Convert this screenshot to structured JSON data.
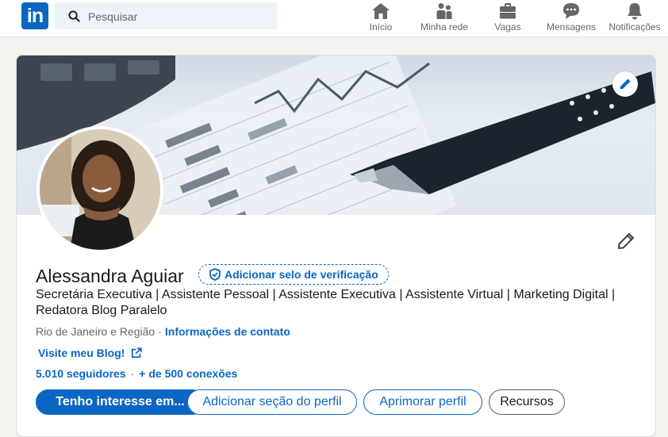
{
  "nav": {
    "logo": "in",
    "search_placeholder": "Pesquisar",
    "items": [
      {
        "label": "Início",
        "icon": "home-icon"
      },
      {
        "label": "Minha rede",
        "icon": "network-icon"
      },
      {
        "label": "Vagas",
        "icon": "briefcase-icon"
      },
      {
        "label": "Mensagens",
        "icon": "messaging-icon"
      },
      {
        "label": "Notificações",
        "icon": "bell-icon"
      }
    ]
  },
  "profile": {
    "name": "Alessandra Aguiar",
    "verify_label": "Adicionar selo de verificação",
    "headline": "Secretária Executiva | Assistente Pessoal | Assistente Executiva | Assistente Virtual | Marketing Digital | Redatora Blog Paralelo",
    "location": "Rio de Janeiro e Região",
    "separator": "·",
    "contact_info": "Informações de contato",
    "website": "Visite meu Blog!",
    "followers": "5.010 seguidores",
    "connections": "+ de 500 conexões"
  },
  "actions": {
    "open_to": "Tenho interesse em...",
    "add_section": "Adicionar seção do perfil",
    "enhance": "Aprimorar perfil",
    "resources": "Recursos"
  },
  "colors": {
    "brand": "#0a66c2",
    "background": "#f4f2ee",
    "text": "#191919",
    "muted": "#666666"
  }
}
